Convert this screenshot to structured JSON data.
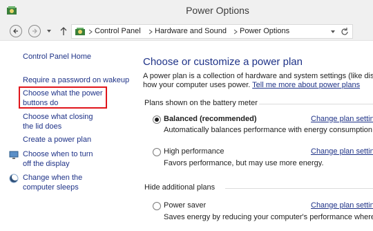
{
  "window": {
    "title": "Power Options"
  },
  "address_bar": {
    "crumbs": [
      "Control Panel",
      "Hardware and Sound",
      "Power Options"
    ]
  },
  "left_pane": {
    "home": "Control Panel Home",
    "items": [
      {
        "label": "Require a password on wakeup"
      },
      {
        "label": "Choose what the power buttons do"
      },
      {
        "label": "Choose what closing the lid does"
      },
      {
        "label": "Create a power plan"
      },
      {
        "label": "Choose when to turn off the display"
      },
      {
        "label": "Change when the computer sleeps"
      }
    ]
  },
  "main": {
    "heading": "Choose or customize a power plan",
    "description_line1": "A power plan is a collection of hardware and system settings (like displ",
    "description_line2_prefix": "how your computer uses power.",
    "description_link": "Tell me more about power plans",
    "battery_section": "Plans shown on the battery meter",
    "additional_section": "Hide additional plans",
    "plans": [
      {
        "name": "Balanced (recommended)",
        "desc": "Automatically balances performance with energy consumption",
        "selected": true
      },
      {
        "name": "High performance",
        "desc": "Favors performance, but may use more energy.",
        "selected": false
      },
      {
        "name": "Power saver",
        "desc": "Saves energy by reducing your computer's performance where p",
        "selected": false
      }
    ],
    "change_settings_link": "Change plan settings"
  },
  "colors": {
    "link": "#1e3287",
    "highlight": "#e0151b"
  }
}
